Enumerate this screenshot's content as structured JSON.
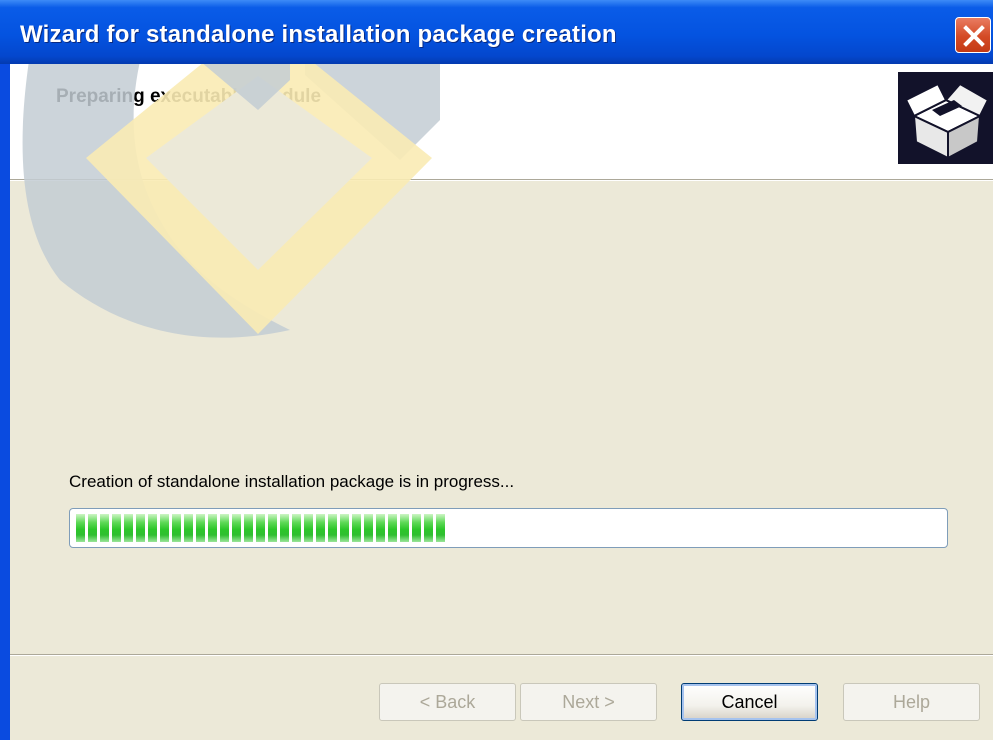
{
  "window": {
    "title": "Wizard for standalone installation package creation"
  },
  "header": {
    "title": "Preparing executable module",
    "icon": "open-box-icon"
  },
  "progress": {
    "label": "Creation of standalone installation package is in progress...",
    "value_percent": 43,
    "color": "#2cc62a"
  },
  "buttons": {
    "back": "< Back",
    "next": "Next >",
    "cancel": "Cancel",
    "help": "Help"
  },
  "colors": {
    "titlebar": "#0453e0",
    "dialog_background": "#ece9d8",
    "close_button": "#d44a25"
  }
}
